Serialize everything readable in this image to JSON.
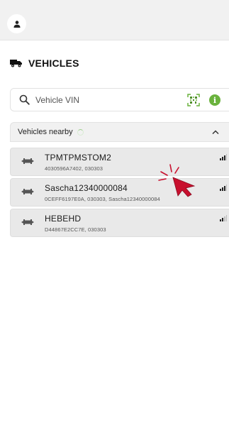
{
  "header": {
    "avatar_icon": "user-icon"
  },
  "section": {
    "title": "VEHICLES",
    "icon": "truck-icon"
  },
  "search": {
    "placeholder": "Vehicle VIN",
    "value": "",
    "scan_icon": "qr-scan-icon",
    "info_icon": "info-icon",
    "info_glyph": "i",
    "info_color": "#6ab23d"
  },
  "nearby": {
    "label": "Vehicles nearby",
    "collapse_icon": "chevron-up-icon"
  },
  "vehicles": [
    {
      "name": "TPMTPMSTOM2",
      "details": "4030596A7402, 030303",
      "signal_level": 3
    },
    {
      "name": "Sascha12340000084",
      "details": "0CEFF6197E0A, 030303, Sascha12340000084",
      "signal_level": 3
    },
    {
      "name": "HEBEHD",
      "details": "D44867E2CC7E, 030303",
      "signal_level": 2
    }
  ],
  "colors": {
    "accent_green": "#6ab23d",
    "cursor_red": "#c8102e",
    "row_bg": "#e9e9e9"
  }
}
